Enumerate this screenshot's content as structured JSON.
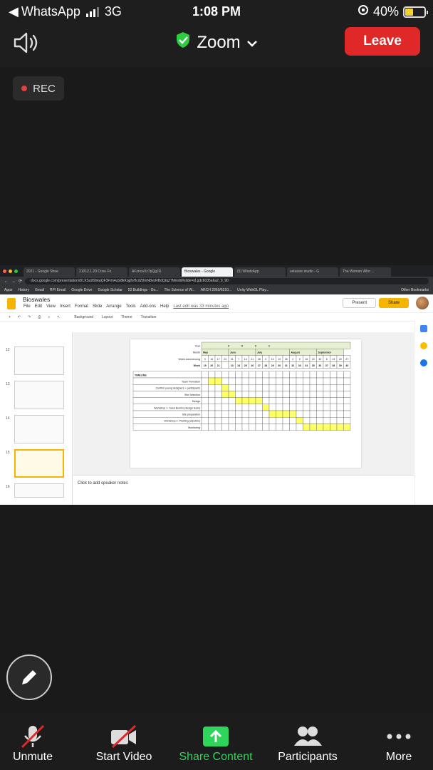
{
  "status_bar": {
    "back_app": "WhatsApp",
    "network": "3G",
    "time": "1:08 PM",
    "battery": "40%",
    "battery_level": 0.4
  },
  "meeting": {
    "title": "Zoom",
    "leave_label": "Leave",
    "rec_label": "REC"
  },
  "browser": {
    "tabs": [
      "2021 - Google Shee",
      "21012.1.20 Cove Fo",
      "AFzncaVz7pQgJ2i",
      "Bioswales - Google",
      "(5) WhatsApp",
      "selassie.studio - G",
      "The Woman Who ..."
    ],
    "active_tab": 3,
    "url": "docs.google.com/presentation/d/1XSu9ShkaQF3Fim4uG8kKqgfoHcdZ9mN8voRBdQIqZ7M/edit#slide=id.gdc6035a6a2_0_90",
    "bookmarks": [
      "Apps",
      "History",
      "Gmail",
      "RPI Email",
      "Google Drive",
      "Google Scholar",
      "52 Buildings - Go...",
      "The Science of W...",
      "ARCH 2960/6310...",
      "Unity WebGL Play..."
    ],
    "other_bookmarks": "Other Bookmarks"
  },
  "doc": {
    "title": "Bioswales",
    "menu": [
      "File",
      "Edit",
      "View",
      "Insert",
      "Format",
      "Slide",
      "Arrange",
      "Tools",
      "Add-ons",
      "Help"
    ],
    "last_edit": "Last edit was 33 minutes ago",
    "present_label": "Present",
    "share_label": "Share",
    "toolbar": [
      "Background",
      "Layout",
      "Theme",
      "Transition"
    ],
    "slide_numbers": [
      "12",
      "13",
      "14",
      "15",
      "16"
    ],
    "notes_placeholder": "Click to add speaker notes"
  },
  "schedule": {
    "year_label": "Year",
    "month_label": "Month",
    "week_commencing_label": "Week commencing",
    "week_label": "Week",
    "timeline_label": "TIMELINE",
    "months": [
      "May",
      "June",
      "July",
      "August",
      "September"
    ],
    "month_spans": [
      4,
      4,
      5,
      4,
      4
    ],
    "year_digits": [
      "2",
      "0",
      "2",
      "1"
    ],
    "week_commencing": [
      "3",
      "10",
      "17",
      "24",
      "31",
      "7",
      "14",
      "21",
      "28",
      "5",
      "12",
      "19",
      "26",
      "2",
      "9",
      "16",
      "23",
      "30",
      "6",
      "13",
      "20",
      "27"
    ],
    "weeks": [
      "19",
      "20",
      "21",
      "",
      "23",
      "24",
      "25",
      "26",
      "27",
      "28",
      "29",
      "30",
      "31",
      "32",
      "33",
      "34",
      "35",
      "36",
      "37",
      "38",
      "39",
      "40"
    ],
    "tasks": [
      {
        "name": "Team Formation",
        "start": 1,
        "end": 2
      },
      {
        "name": "Confirm young designers + participants",
        "start": 3,
        "end": 3
      },
      {
        "name": "Site Selection",
        "start": 3,
        "end": 4
      },
      {
        "name": "Design",
        "start": 5,
        "end": 8
      },
      {
        "name": "Workshop 1- Seed Bombs (design team)",
        "start": 9,
        "end": 9
      },
      {
        "name": "Site preparation",
        "start": 10,
        "end": 13
      },
      {
        "name": "Workshop 2- Planting (w/public)",
        "start": 14,
        "end": 14
      },
      {
        "name": "Monitoring",
        "start": 15,
        "end": 21
      }
    ]
  },
  "toolbar_bottom": {
    "unmute": "Unmute",
    "start_video": "Start Video",
    "share_content": "Share Content",
    "participants": "Participants",
    "more": "More"
  },
  "colors": {
    "leave": "#e02828",
    "share_green": "#2dd55b",
    "gantt_fill": "#ffff66",
    "header_fill": "#e6f0d0"
  }
}
